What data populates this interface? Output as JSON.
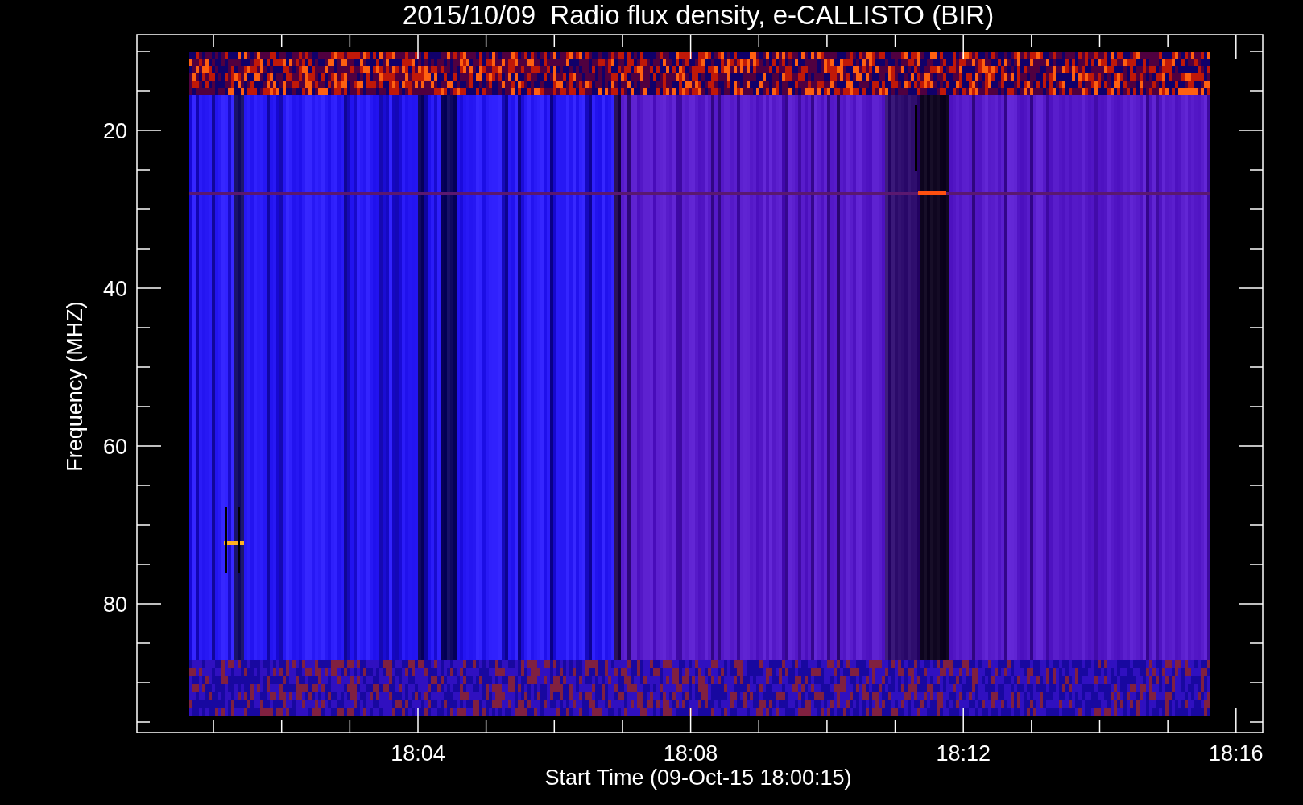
{
  "title": "2015/10/09  Radio flux density, e-CALLISTO (BIR)",
  "y_axis": {
    "label": "Frequency (MHZ)",
    "ticks": [
      "20",
      "40",
      "60",
      "80"
    ]
  },
  "x_axis": {
    "label": "Start Time (09-Oct-15 18:00:15)",
    "ticks": [
      "18:04",
      "18:08",
      "18:12",
      "18:16"
    ]
  }
}
